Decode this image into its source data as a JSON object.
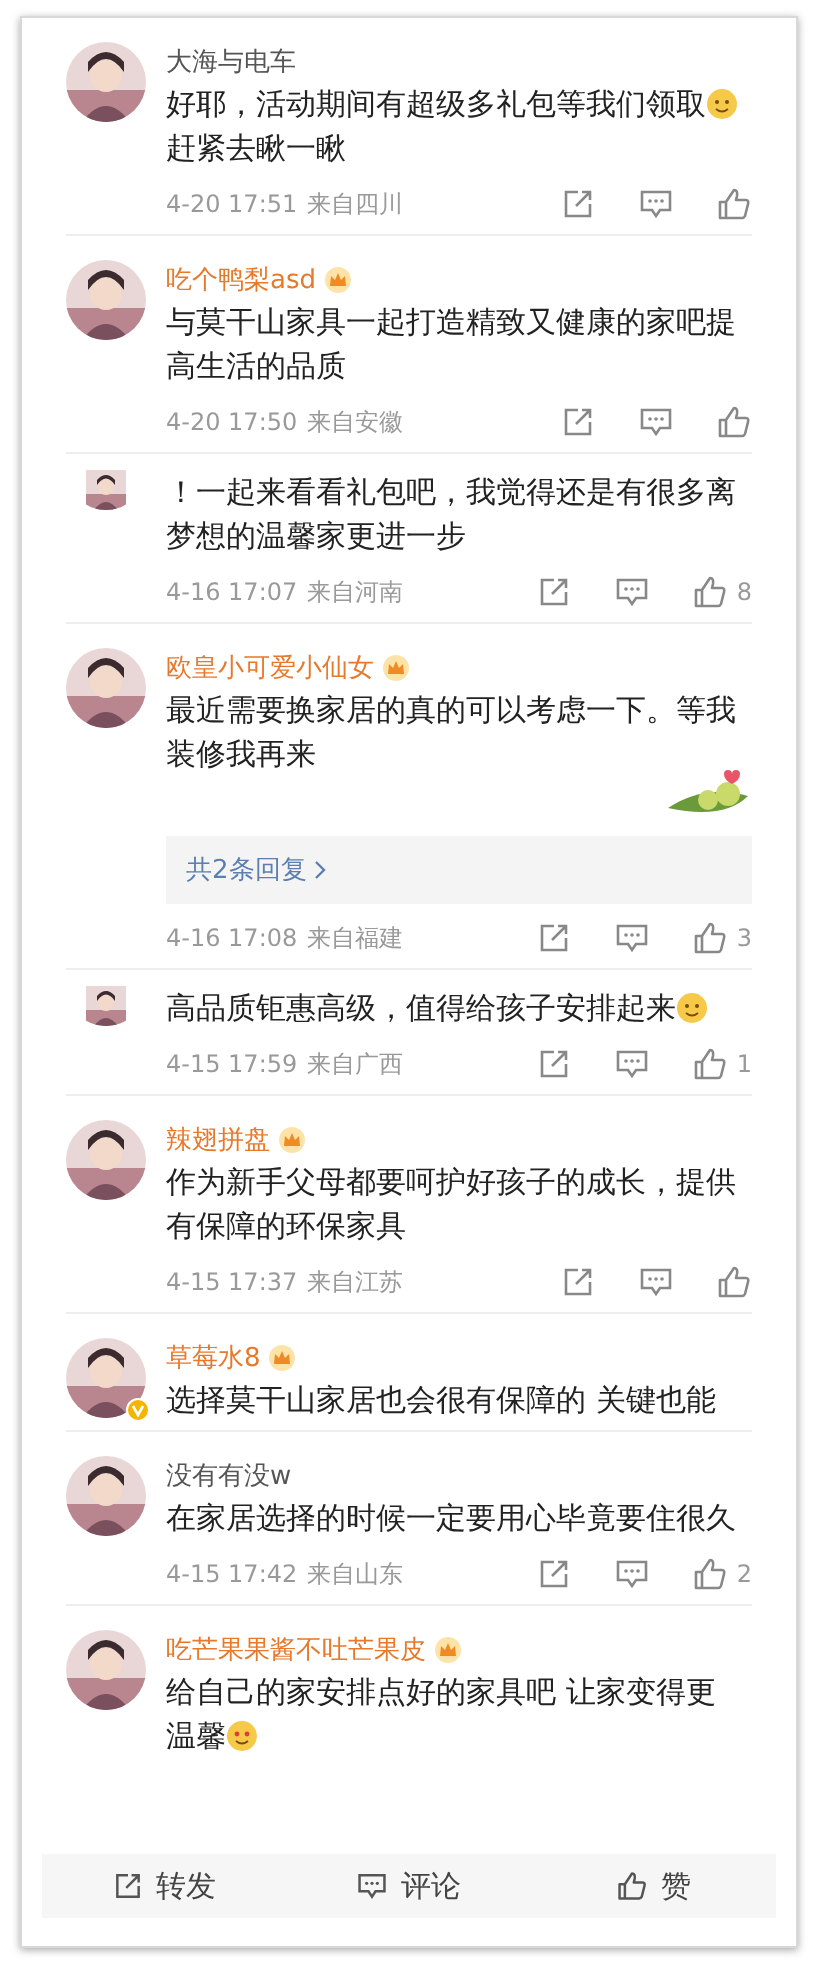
{
  "comments": [
    {
      "name": "大海与电车",
      "vip": false,
      "cut_top": false,
      "text": "好耶，活动期间有超级多礼包等我们领取",
      "emoji": true,
      "text_2": "赶紧去瞅一瞅",
      "time": "4-20 17:51",
      "location": "来自四川"
    },
    {
      "name": "吃个鸭梨asd",
      "vip": true,
      "cut_top": false,
      "text": "与莫干山家具一起打造精致又健康的家吧提高生活的品质",
      "emoji": false,
      "time": "4-20 17:50",
      "location": "来自安徽"
    },
    {
      "cut_top": true,
      "vip": false,
      "text": "！一起来看看礼包吧，我觉得还是有很多离梦想的温馨家更进一步",
      "emoji": false,
      "time": "4-16 17:07",
      "location": "来自河南",
      "likes": "8"
    },
    {
      "name": "欧皇小可爱小仙女",
      "vip": true,
      "cut_top": false,
      "text": "最近需要换家居的真的可以考虑一下。等我装修我再来",
      "emoji": false,
      "sticker": true,
      "replies": "共2条回复",
      "time": "4-16 17:08",
      "location": "来自福建",
      "likes": "3"
    },
    {
      "cut_top": true,
      "vip": false,
      "text": "高品质钜惠高级，值得给孩子安排起来",
      "emoji": true,
      "time": "4-15 17:59",
      "location": "来自广西",
      "likes": "1"
    },
    {
      "name": "辣翅拼盘",
      "vip": true,
      "cut_top": false,
      "text": "作为新手父母都要呵护好孩子的成长，提供有保障的环保家具",
      "emoji": false,
      "time": "4-15 17:37",
      "location": "来自江苏"
    },
    {
      "name": "草莓水8",
      "vip": true,
      "verified": true,
      "cut_top": false,
      "text": "选择莫干山家居也会很有保障的 关键也能",
      "emoji": false
    },
    {
      "name": "没有有没w",
      "vip": false,
      "cut_top": false,
      "text": "在家居选择的时候一定要用心毕竟要住很久",
      "emoji": false,
      "time": "4-15 17:42",
      "location": "来自山东",
      "likes": "2"
    },
    {
      "name": "吃芒果果酱不吐芒果皮",
      "vip": true,
      "cut_top": false,
      "text": "给自己的家安排点好的家具吧 让家变得更",
      "emoji": false,
      "text_2": "温馨",
      "emoji_2": true
    }
  ],
  "bottom_bar": [
    {
      "kind": "repost",
      "label": "转发"
    },
    {
      "kind": "comment",
      "label": "评论"
    },
    {
      "kind": "like",
      "label": "赞"
    }
  ]
}
